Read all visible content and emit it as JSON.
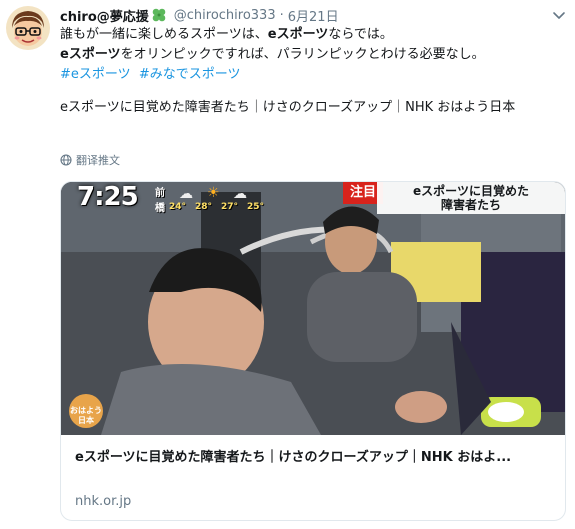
{
  "tweet": {
    "author_name": "chiro@夢応援",
    "author_handle": "@chirochiro333",
    "separator": "·",
    "date": "6月21日",
    "avatar_icon": "cartoon-avatar-icon",
    "lines": [
      [
        "誰もが一緒に楽しめるスポーツは、",
        "eスポーツ",
        "ならでは。"
      ],
      [
        "eスポーツ",
        "をオリンピックですれば、パラリンピックとわける必要なし。"
      ]
    ],
    "hashtags": [
      "#eスポーツ",
      "#みなでスポーツ"
    ],
    "link_line": "eスポーツに目覚めた障害者たち｜けさのクローズアップ｜NHK おはよう日本",
    "translate_label": "翻译推文"
  },
  "card": {
    "title": "eスポーツに目覚めた障害者たち｜けさのクローズアップ｜NHK おはよ...",
    "domain": "nhk.or.jp",
    "image": {
      "clock": "7:25",
      "weather": {
        "cities": [
          "前",
          "橋"
        ],
        "temps": [
          "24°",
          "28°",
          "27°",
          "25°"
        ]
      },
      "badge": "注目",
      "banner_lines": [
        "eスポーツに目覚めた",
        "障害者たち"
      ],
      "logo_lines": [
        "おはよう",
        "日本"
      ]
    }
  },
  "colors": {
    "link": "#1b95e0",
    "muted": "#657786",
    "badge": "#d8231c"
  }
}
